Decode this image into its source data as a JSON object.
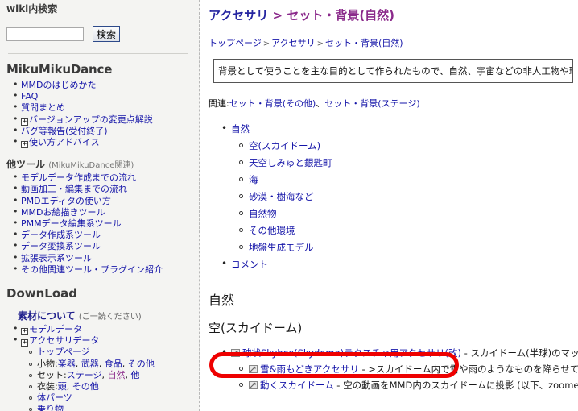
{
  "sidebar": {
    "search_heading": "wiki内検索",
    "search_value": "",
    "search_placeholder": "",
    "search_button": "検索",
    "section1_title": "MikuMikuDance",
    "section1_items": [
      {
        "label": "MMDのはじめかた",
        "expand": false
      },
      {
        "label": "FAQ",
        "expand": false
      },
      {
        "label": "質問まとめ",
        "expand": false
      },
      {
        "label": "バージョンアップの変更点解説",
        "expand": true
      },
      {
        "label": "バグ等報告(受付終了)",
        "expand": false
      },
      {
        "label": "使い方アドバイス",
        "expand": true
      }
    ],
    "section2_title": "他ツール",
    "section2_note": "(MikuMikuDance関連)",
    "section2_items": [
      {
        "label": "モデルデータ作成までの流れ"
      },
      {
        "label": "動画加工・編集までの流れ"
      },
      {
        "label": "PMDエディタの使い方"
      },
      {
        "label": "MMDお絵描きツール"
      },
      {
        "label": "PMMデータ編集系ツール"
      },
      {
        "label": "データ作成系ツール"
      },
      {
        "label": "データ変換系ツール"
      },
      {
        "label": "拡張表示系ツール"
      },
      {
        "label": "その他関連ツール・プラグイン紹介"
      }
    ],
    "download_title": "DownLoad",
    "material_title": "素材について",
    "material_note": "(ご一読ください)",
    "download_items": [
      {
        "label": "モデルデータ",
        "expand": true
      },
      {
        "label": "アクセサリデータ",
        "expand": true
      }
    ],
    "accessory_subitems": [
      {
        "prefix": "",
        "label": "トップページ",
        "parts": []
      },
      {
        "prefix": "小物:",
        "label": "",
        "parts": [
          {
            "t": "楽器",
            "cur": false
          },
          {
            "t": ", ",
            "plain": true
          },
          {
            "t": "武器",
            "cur": false
          },
          {
            "t": ", ",
            "plain": true
          },
          {
            "t": "食品",
            "cur": false
          },
          {
            "t": ", ",
            "plain": true
          },
          {
            "t": "その他",
            "cur": false
          }
        ]
      },
      {
        "prefix": "セット:",
        "label": "",
        "parts": [
          {
            "t": "ステージ",
            "cur": false
          },
          {
            "t": ", ",
            "plain": true
          },
          {
            "t": "自然",
            "cur": true
          },
          {
            "t": ", ",
            "plain": true
          },
          {
            "t": "他",
            "cur": false
          }
        ]
      },
      {
        "prefix": "衣装:",
        "label": "",
        "parts": [
          {
            "t": "頭",
            "cur": false
          },
          {
            "t": ", ",
            "plain": true
          },
          {
            "t": "その他",
            "cur": false
          }
        ]
      },
      {
        "prefix": "",
        "label": "体パーツ",
        "parts": []
      },
      {
        "prefix": "",
        "label": "乗り物",
        "parts": []
      }
    ]
  },
  "main": {
    "title_primary": "アクセサリ",
    "title_sep": ">",
    "title_secondary": "セット・背景(自然)",
    "breadcrumb": [
      {
        "label": "トップページ",
        "link": true
      },
      {
        "label": ">",
        "link": false
      },
      {
        "label": "アクセサリ",
        "link": true
      },
      {
        "label": ">",
        "link": false
      },
      {
        "label": "セット・背景(自然)",
        "link": true
      }
    ],
    "description": "背景として使うことを主な目的として作られたもので、自然、宇宙などの非人工物や環境を扱",
    "related_label": "関連:",
    "related_links": [
      "セット・背景(その他)",
      "セット・背景(ステージ)"
    ],
    "related_sep": "、",
    "toc_root": "自然",
    "toc_children": [
      "空(スカイドーム)",
      "天空しみゅと銀匙町",
      "海",
      "砂漠・樹海など",
      "自然物",
      "その他環境",
      "地盤生成モデル"
    ],
    "toc_comment": "コメント",
    "section_heading": "自然",
    "subsection_heading": "空(スカイドーム)",
    "items": [
      {
        "icon": "external-link-icon",
        "link": "球状Skybox(Skydome)テクスチャ用アクセサリ(改)",
        "desc": " - スカイドーム(半球)のマッピン",
        "level": 1,
        "highlighted": true
      },
      {
        "icon": "external-link-icon",
        "link": "雪&雨もどきアクセサリ",
        "desc": " - >スカイドーム内で雪や雨のようなものを降らせてみ",
        "level": 2,
        "highlighted": false
      },
      {
        "icon": "external-link-icon",
        "link": "動くスカイドーム",
        "desc": " - 空の動画をMMD内のスカイドームに投影 (以下、zoomeへ",
        "level": 2,
        "highlighted": false
      }
    ]
  },
  "annotation": {
    "shape": "ellipse",
    "color": "#ee0000",
    "target": "球状Skybox(Skydome)テクスチャ用アクセサリ(改)"
  }
}
